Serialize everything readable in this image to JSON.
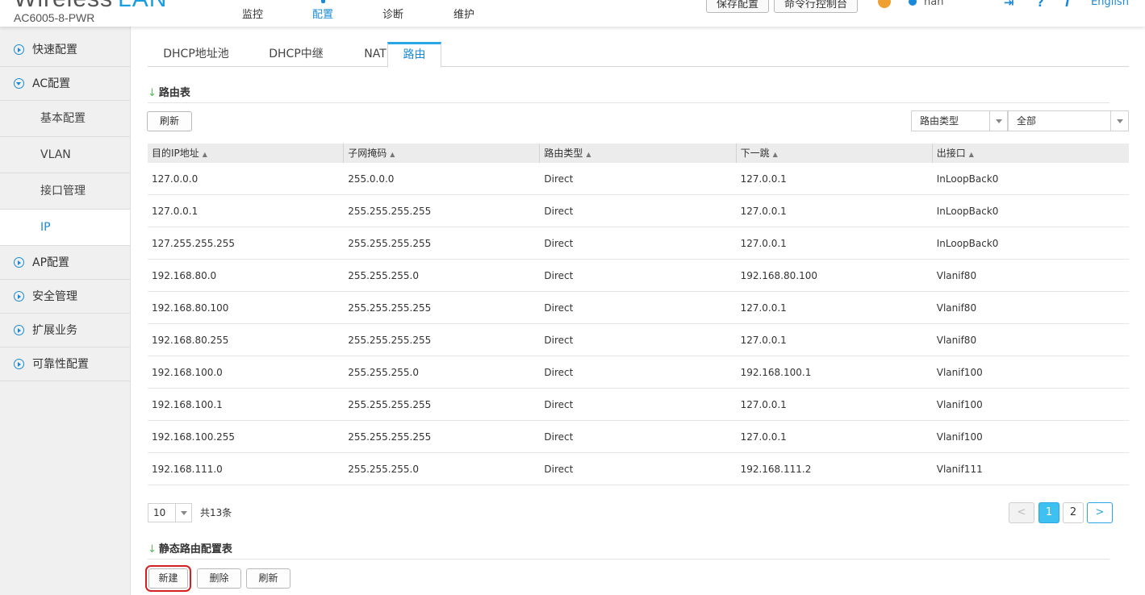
{
  "header": {
    "brand_word": "Wireless",
    "brand_lan": "LAN",
    "model": "AC6005-8-PWR",
    "nav": [
      {
        "label": "监控",
        "active": false
      },
      {
        "label": "配置",
        "active": true
      },
      {
        "label": "诊断",
        "active": false
      },
      {
        "label": "维护",
        "active": false
      }
    ],
    "save_config": "保存配置",
    "cli_console": "命令行控制台",
    "username": "nan",
    "language": "English"
  },
  "sidebar": {
    "items": [
      {
        "label": "快速配置"
      },
      {
        "label": "AC配置"
      },
      {
        "label": "基本配置"
      },
      {
        "label": "VLAN"
      },
      {
        "label": "接口管理"
      },
      {
        "label": "IP"
      },
      {
        "label": "AP配置"
      },
      {
        "label": "安全管理"
      },
      {
        "label": "扩展业务"
      },
      {
        "label": "可靠性配置"
      }
    ]
  },
  "tabs": [
    {
      "label": "DHCP地址池"
    },
    {
      "label": "DHCP中继"
    },
    {
      "label": "NAT"
    },
    {
      "label": "路由"
    }
  ],
  "route_table": {
    "title": "路由表",
    "refresh_label": "刷新",
    "filter_label": "路由类型",
    "filter_value": "全部",
    "columns": [
      "目的IP地址",
      "子网掩码",
      "路由类型",
      "下一跳",
      "出接口"
    ],
    "rows": [
      [
        "127.0.0.0",
        "255.0.0.0",
        "Direct",
        "127.0.0.1",
        "InLoopBack0"
      ],
      [
        "127.0.0.1",
        "255.255.255.255",
        "Direct",
        "127.0.0.1",
        "InLoopBack0"
      ],
      [
        "127.255.255.255",
        "255.255.255.255",
        "Direct",
        "127.0.0.1",
        "InLoopBack0"
      ],
      [
        "192.168.80.0",
        "255.255.255.0",
        "Direct",
        "192.168.80.100",
        "Vlanif80"
      ],
      [
        "192.168.80.100",
        "255.255.255.255",
        "Direct",
        "127.0.0.1",
        "Vlanif80"
      ],
      [
        "192.168.80.255",
        "255.255.255.255",
        "Direct",
        "127.0.0.1",
        "Vlanif80"
      ],
      [
        "192.168.100.0",
        "255.255.255.0",
        "Direct",
        "192.168.100.1",
        "Vlanif100"
      ],
      [
        "192.168.100.1",
        "255.255.255.255",
        "Direct",
        "127.0.0.1",
        "Vlanif100"
      ],
      [
        "192.168.100.255",
        "255.255.255.255",
        "Direct",
        "127.0.0.1",
        "Vlanif100"
      ],
      [
        "192.168.111.0",
        "255.255.255.0",
        "Direct",
        "192.168.111.2",
        "Vlanif111"
      ]
    ],
    "page_size": "10",
    "total": "共13条",
    "pages": [
      "1",
      "2"
    ]
  },
  "static_route": {
    "title": "静态路由配置表",
    "new_label": "新建",
    "delete_label": "删除",
    "refresh_label": "刷新"
  },
  "colors": {
    "accent": "#1a8ad8",
    "highlight": "#d42020"
  }
}
